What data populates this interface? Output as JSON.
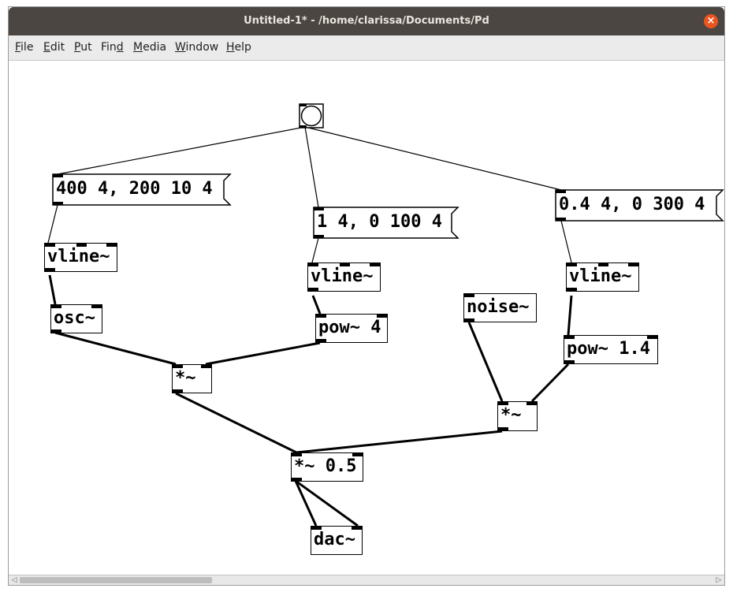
{
  "window": {
    "title": "Untitled-1* - /home/clarissa/Documents/Pd",
    "close_label": "×"
  },
  "menu": [
    {
      "key": "F",
      "rest": "ile"
    },
    {
      "key": "E",
      "rest": "dit"
    },
    {
      "key": "P",
      "rest": "ut"
    },
    {
      "pre": "Fin",
      "key": "d",
      "rest": ""
    },
    {
      "key": "M",
      "rest": "edia"
    },
    {
      "key": "W",
      "rest": "indow"
    },
    {
      "key": "H",
      "rest": "elp"
    }
  ],
  "patch": {
    "messages": {
      "msg1": "400 4, 200 10 4",
      "msg2": "1 4, 0 100 4",
      "msg3": "0.4 4, 0 300 4"
    },
    "objects": {
      "vline1": "vline~",
      "osc": "osc~",
      "vline2": "vline~",
      "pow4": "pow~ 4",
      "noise": "noise~",
      "vline3": "vline~",
      "pow14": "pow~ 1.4",
      "mul1": "*~",
      "mul2": "*~",
      "mul05": "*~ 0.5",
      "dac": "dac~"
    }
  },
  "scrollbar": {
    "left_arrow": "◁",
    "right_arrow": "▷"
  }
}
